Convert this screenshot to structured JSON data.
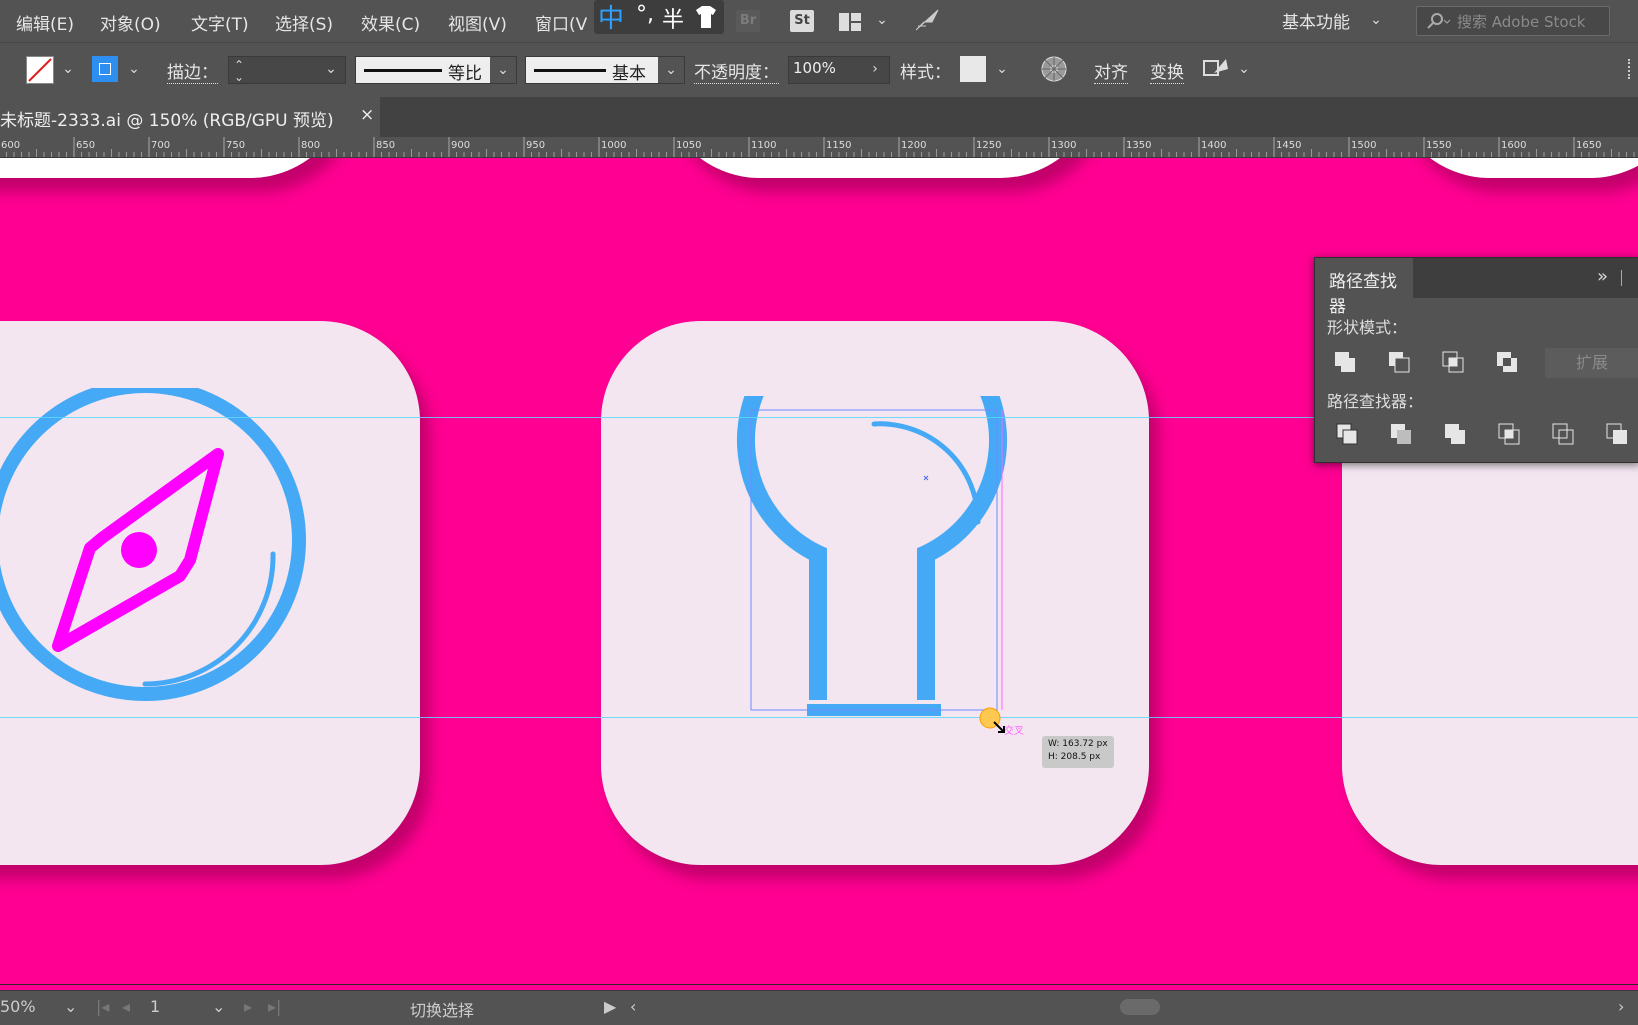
{
  "menu": [
    "编辑(E)",
    "对象(O)",
    "文字(T)",
    "选择(S)",
    "效果(C)",
    "视图(V)",
    "窗口(V"
  ],
  "ime": {
    "mode": "中",
    "punct": "°,",
    "width": "半"
  },
  "top_icons": {
    "bridge": "Br",
    "stock": "St"
  },
  "workspace": "基本功能",
  "search": {
    "placeholder": "搜索 Adobe Stock"
  },
  "control": {
    "stroke_label": "描边：",
    "profile_label": "等比",
    "brush_label": "基本",
    "opacity_label": "不透明度：",
    "opacity_value": "100%",
    "style_label": "样式：",
    "align_label": "对齐",
    "transform_label": "变换"
  },
  "document": {
    "tab_title": "未标题-2333.ai @ 150% (RGB/GPU 预览)",
    "close": "×"
  },
  "ruler": {
    "ticks": [
      "600",
      "650",
      "700",
      "750",
      "800",
      "850",
      "900",
      "950",
      "1000",
      "1050",
      "1100",
      "1150",
      "1200",
      "1250",
      "1300",
      "1350",
      "1400",
      "1450",
      "1500",
      "1550",
      "1600",
      "1650"
    ]
  },
  "colors": {
    "canvas": "#ff0092",
    "card": "#f3e6f1",
    "icon_blue": "#45a9f5",
    "icon_magenta": "#ff00ff",
    "guide": "#5ad8ff"
  },
  "canvas": {
    "smart_guide_label": "交叉",
    "measure": {
      "w": "W: 163.72 px",
      "h": "H: 208.5 px"
    }
  },
  "pathfinder": {
    "title": "路径查找器",
    "menu_glyph": "»",
    "shape_modes_label": "形状模式：",
    "expand_label": "扩展",
    "pathfinders_label": "路径查找器："
  },
  "status": {
    "zoom": "50%",
    "page": "1",
    "tool": "切换选择"
  }
}
